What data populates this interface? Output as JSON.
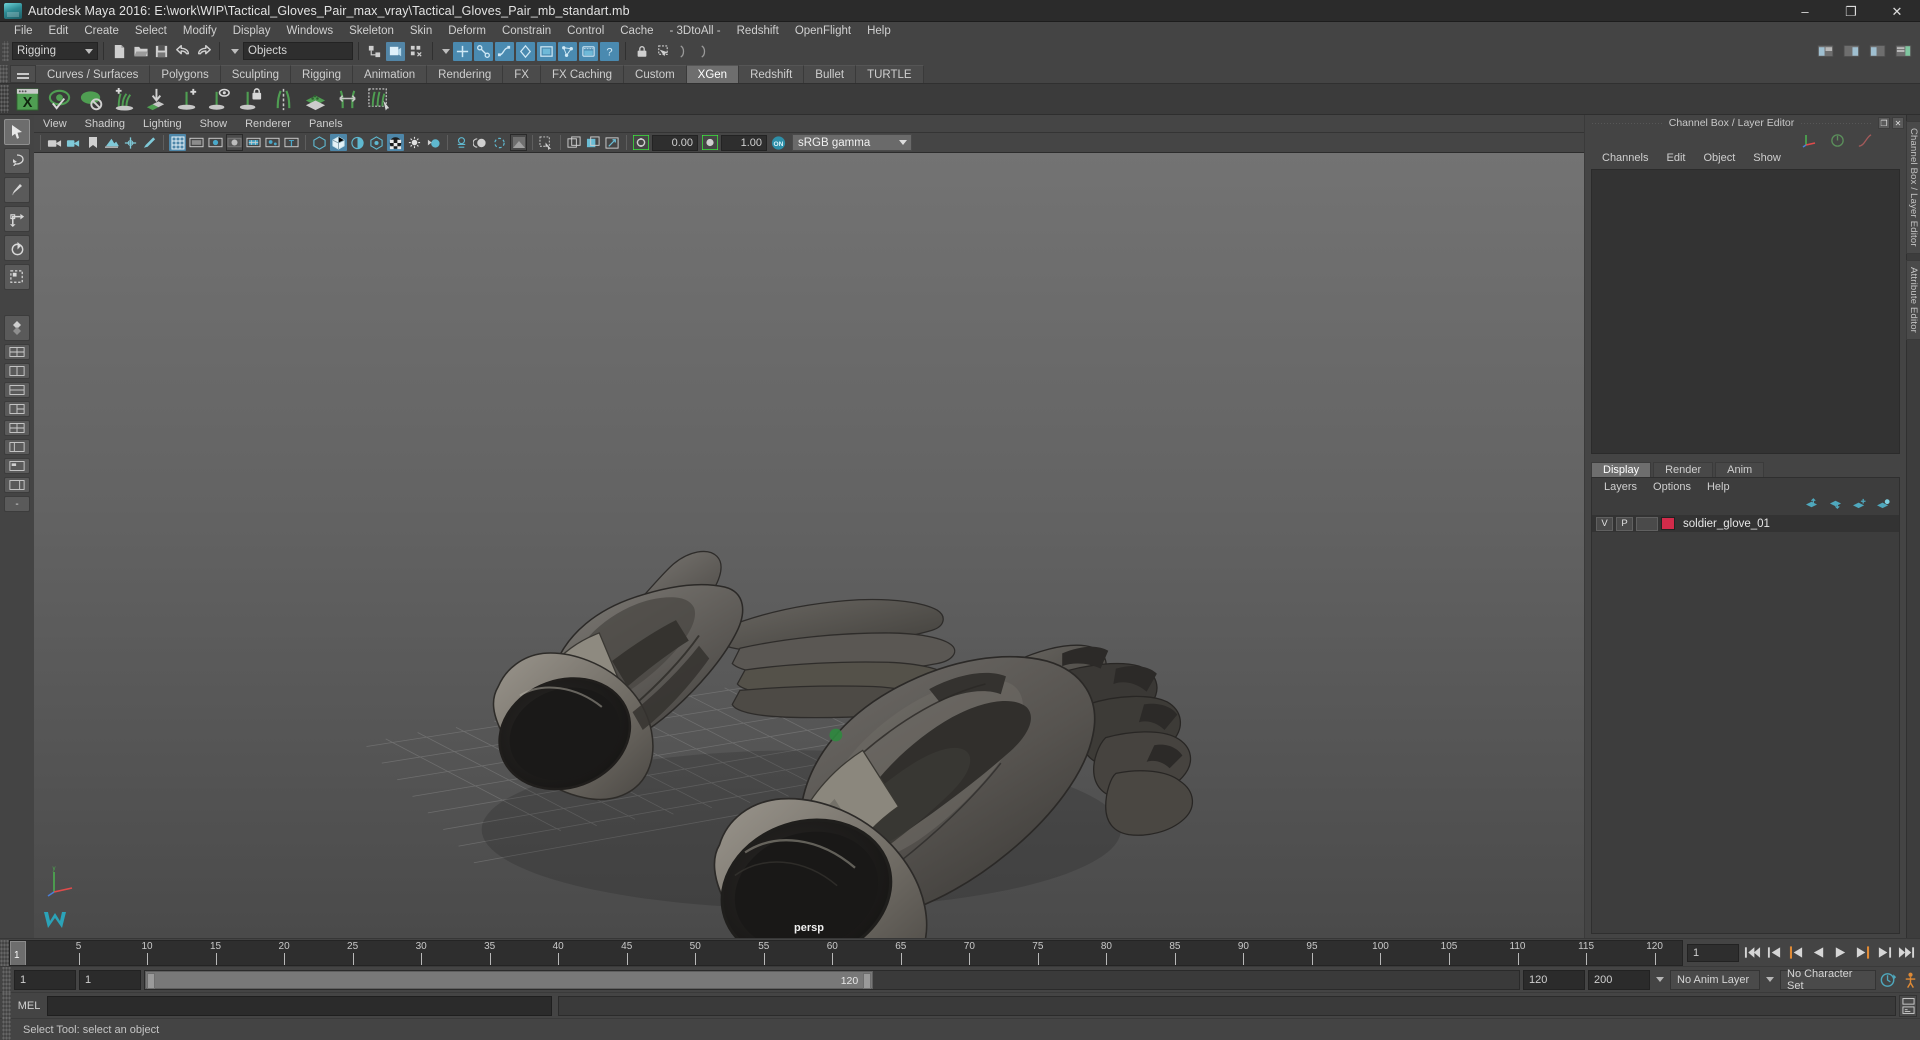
{
  "window": {
    "title": "Autodesk Maya 2016: E:\\work\\WIP\\Tactical_Gloves_Pair_max_vray\\Tactical_Gloves_Pair_mb_standart.mb",
    "minimize": "–",
    "maximize": "❐",
    "close": "✕"
  },
  "menubar": {
    "items": [
      {
        "label": "File"
      },
      {
        "label": "Edit"
      },
      {
        "label": "Create"
      },
      {
        "label": "Select"
      },
      {
        "label": "Modify"
      },
      {
        "label": "Display"
      },
      {
        "label": "Windows"
      },
      {
        "label": "Skeleton"
      },
      {
        "label": "Skin"
      },
      {
        "label": "Deform"
      },
      {
        "label": "Constrain"
      },
      {
        "label": "Control"
      },
      {
        "label": "Cache"
      },
      {
        "label": "- 3DtoAll -"
      },
      {
        "label": "Redshift"
      },
      {
        "label": "OpenFlight"
      },
      {
        "label": "Help"
      }
    ]
  },
  "statusbar": {
    "menuset": "Rigging",
    "selection_mask": "Objects"
  },
  "shelf": {
    "tabs": [
      {
        "label": "Curves / Surfaces",
        "active": false
      },
      {
        "label": "Polygons",
        "active": false
      },
      {
        "label": "Sculpting",
        "active": false
      },
      {
        "label": "Rigging",
        "active": false
      },
      {
        "label": "Animation",
        "active": false
      },
      {
        "label": "Rendering",
        "active": false
      },
      {
        "label": "FX",
        "active": false
      },
      {
        "label": "FX Caching",
        "active": false
      },
      {
        "label": "Custom",
        "active": false
      },
      {
        "label": "XGen",
        "active": true
      },
      {
        "label": "Redshift",
        "active": false
      },
      {
        "label": "Bullet",
        "active": false
      },
      {
        "label": "TURTLE",
        "active": false
      }
    ],
    "icons": [
      "xgen-editor-icon",
      "xgen-preview-visible-icon",
      "xgen-preview-off-icon",
      "xgen-add-guides-icon",
      "xgen-guide-to-surface-icon",
      "xgen-add-guide-icon",
      "xgen-select-guide-icon",
      "xgen-lock-guide-icon",
      "xgen-mirror-guides-icon",
      "xgen-density-icon",
      "xgen-length-icon",
      "xgen-select-region-icon"
    ]
  },
  "viewport": {
    "menu": [
      {
        "label": "View"
      },
      {
        "label": "Shading"
      },
      {
        "label": "Lighting"
      },
      {
        "label": "Show"
      },
      {
        "label": "Renderer"
      },
      {
        "label": "Panels"
      }
    ],
    "camera_label": "persp",
    "exposure": "0.00",
    "gamma": "1.00",
    "color_profile": "sRGB gamma",
    "gamma_toggle": "ON"
  },
  "right_panel": {
    "title": "Channel Box / Layer Editor",
    "restore_icon": "❐",
    "close_icon": "✕",
    "channelbox_menu": [
      {
        "label": "Channels"
      },
      {
        "label": "Edit"
      },
      {
        "label": "Object"
      },
      {
        "label": "Show"
      }
    ],
    "layer_tabs": [
      {
        "label": "Display",
        "active": true
      },
      {
        "label": "Render",
        "active": false
      },
      {
        "label": "Anim",
        "active": false
      }
    ],
    "layer_menu": [
      {
        "label": "Layers"
      },
      {
        "label": "Options"
      },
      {
        "label": "Help"
      }
    ],
    "layers": [
      {
        "visibility": "V",
        "playback": "P",
        "shading": "",
        "color": "#d12b4a",
        "name": "soldier_glove_01"
      }
    ]
  },
  "edge_tabs": [
    {
      "label": "Channel Box / Layer Editor"
    },
    {
      "label": "Attribute Editor"
    }
  ],
  "timeline": {
    "ticks": [
      5,
      10,
      15,
      20,
      25,
      30,
      35,
      40,
      45,
      50,
      55,
      60,
      65,
      70,
      75,
      80,
      85,
      90,
      95,
      100,
      105,
      110,
      115,
      120
    ],
    "cursor_frame": "1",
    "end_label": "120",
    "current_frame": "1",
    "playback_buttons": [
      "go-to-start-icon",
      "step-back-key-icon",
      "step-back-frame-icon",
      "play-backwards-icon",
      "play-forwards-icon",
      "step-forward-frame-icon",
      "step-forward-key-icon",
      "go-to-end-icon"
    ]
  },
  "range": {
    "start": "1",
    "range_start": "1",
    "slider_start_label": "1",
    "slider_end_label": "120",
    "range_end": "120",
    "end": "200",
    "anim_layer": "No Anim Layer",
    "character_set": "No Character Set"
  },
  "command_line": {
    "language": "MEL",
    "input_value": "",
    "output_value": ""
  },
  "status": {
    "message": "Select Tool: select an object"
  },
  "colors": {
    "accent_blue": "#4d86a8",
    "shelf_green": "#4f9e52",
    "layer_red": "#d12b4a",
    "panel_bg": "#444444",
    "field_bg": "#2e2e2e"
  }
}
